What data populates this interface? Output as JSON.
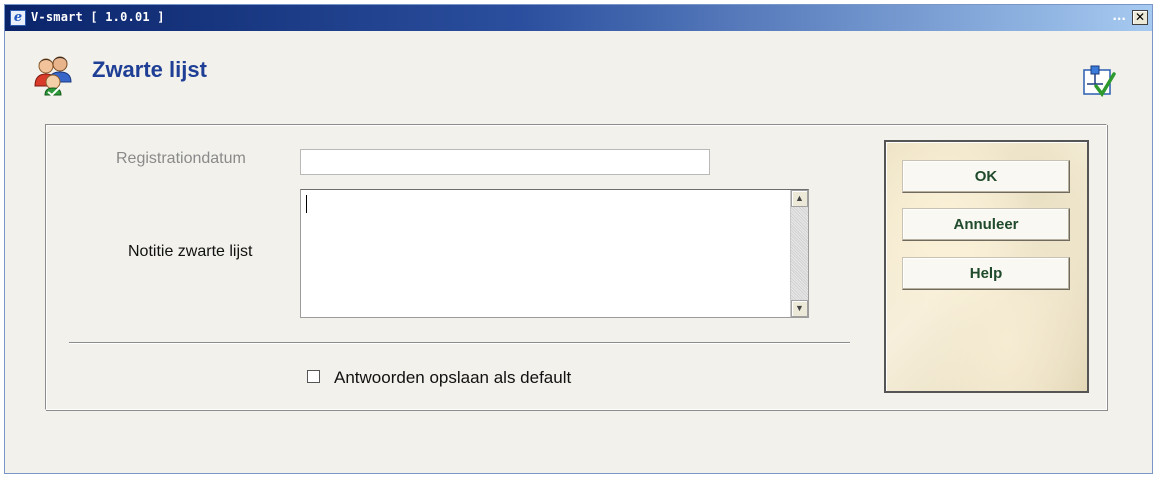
{
  "window": {
    "title": "V-smart [ 1.0.01 ]",
    "title_dots": "...",
    "close_glyph": "✕"
  },
  "header": {
    "title": "Zwarte lijst",
    "icon": "users-group-icon",
    "wizard_icon": "wizard-check-icon"
  },
  "form": {
    "registration_label": "Registrationdatum",
    "registration_value": "",
    "note_label": "Notitie zwarte lijst",
    "note_value": "",
    "save_defaults_label": "Antwoorden opslaan als default",
    "save_defaults_checked": false
  },
  "buttons": {
    "ok": "OK",
    "cancel": "Annuleer",
    "help": "Help"
  },
  "colors": {
    "title_text": "#1f3f96",
    "button_text": "#1f4a2b",
    "titlebar_start": "#0a246a"
  }
}
